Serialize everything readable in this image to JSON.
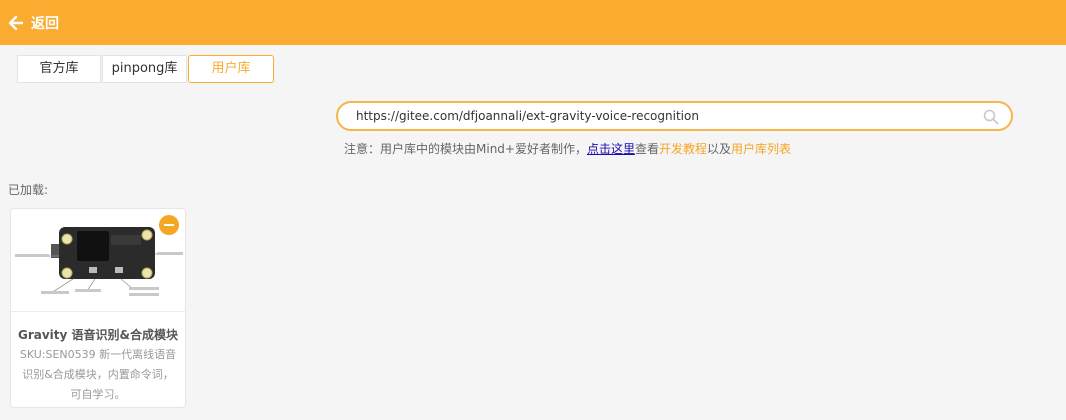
{
  "header": {
    "back_label": "返回"
  },
  "tabs": [
    {
      "label": "官方库"
    },
    {
      "label": "pinpong库"
    },
    {
      "label": "用户库"
    }
  ],
  "search": {
    "value": "https://gitee.com/dfjoannali/ext-gravity-voice-recognition"
  },
  "notice": {
    "prefix": "注意：用户库中的模块由Mind+爱好者制作，",
    "link": "点击这里",
    "middle1": "查看",
    "tutorial": "开发教程",
    "middle2": "以及",
    "list": "用户库列表"
  },
  "loaded": {
    "label": "已加载:",
    "items": [
      {
        "title": "Gravity 语音识别&合成模块",
        "desc": "SKU:SEN0539 新一代离线语音识别&合成模块，内置命令词，可自学习。"
      }
    ]
  },
  "colors": {
    "accent": "#f9ac30",
    "link": "#1a0dab"
  }
}
